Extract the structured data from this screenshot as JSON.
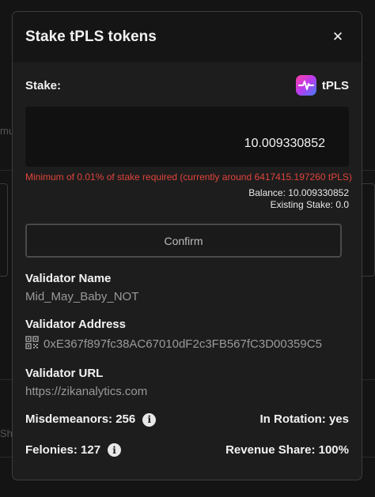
{
  "background": {
    "frag_left_1": "mu",
    "frag_left_2": "Sh"
  },
  "modal": {
    "title": "Stake tPLS tokens",
    "close_glyph": "✕"
  },
  "stake": {
    "label": "Stake:",
    "token_name": "tPLS",
    "amount_value": "10.009330852",
    "error": "Minimum of 0.01% of stake required (currently around 6417415.197260 tPLS)",
    "balance": "Balance: 10.009330852",
    "existing_stake": "Existing Stake: 0.0",
    "confirm_label": "Confirm"
  },
  "validator": {
    "name_label": "Validator Name",
    "name_value": "Mid_May_Baby_NOT",
    "address_label": "Validator Address",
    "address_value": "0xE367f897fc38AC67010dF2c3FB567fC3D00359C5",
    "url_label": "Validator URL",
    "url_value": "https://zikanalytics.com",
    "misdemeanors": "Misdemeanors: 256",
    "in_rotation": "In Rotation: yes",
    "felonies": "Felonies: 127",
    "revenue_share": "Revenue Share: 100%"
  },
  "icons": {
    "info_glyph": "i",
    "close": "close-icon",
    "qr": "qr-code-icon",
    "info": "info-icon",
    "token": "pulse-logo-icon"
  },
  "colors": {
    "error": "#e0443b",
    "modal_bg": "#1d1d1d",
    "header_bg": "#151515"
  }
}
